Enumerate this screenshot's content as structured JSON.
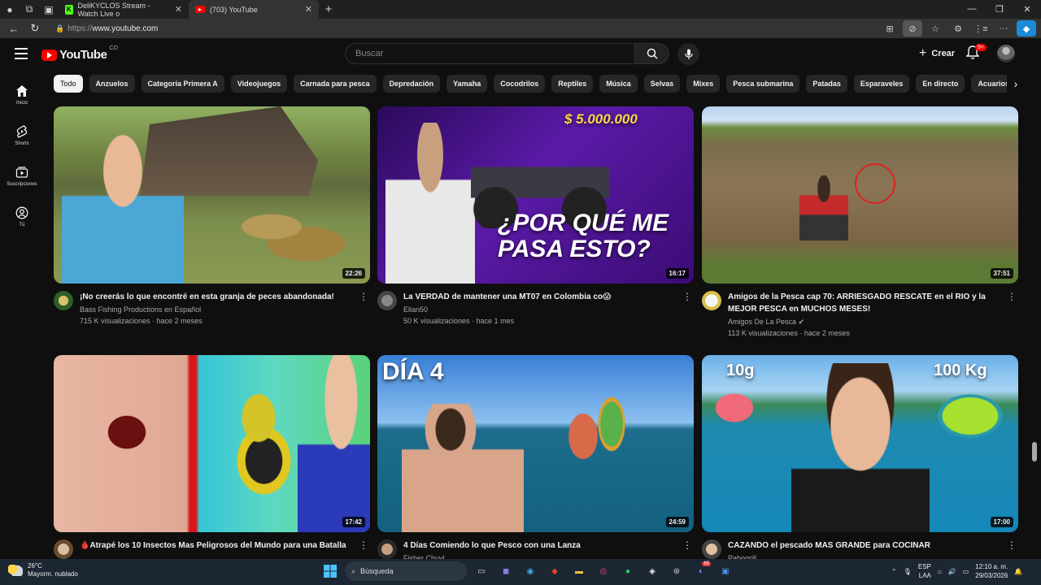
{
  "browser": {
    "tabs": [
      {
        "title": "DeliKYCLOS Stream - Watch Live o",
        "active": false
      },
      {
        "title": "(703) YouTube",
        "active": true
      }
    ],
    "url_protocol": "https://",
    "url_host": "www.youtube.com"
  },
  "header": {
    "logo_text": "YouTube",
    "country_code": "CO",
    "search_placeholder": "Buscar",
    "create_label": "Crear",
    "notifications_badge": "9+"
  },
  "sidebar": {
    "items": [
      {
        "label": "Inicio",
        "icon": "home-icon"
      },
      {
        "label": "Shorts",
        "icon": "shorts-icon"
      },
      {
        "label": "Suscripciones",
        "icon": "subscriptions-icon"
      },
      {
        "label": "Tú",
        "icon": "you-icon"
      }
    ]
  },
  "chips": [
    "Todo",
    "Anzuelos",
    "Categoría Primera A",
    "Videojuegos",
    "Carnada para pesca",
    "Depredación",
    "Yamaha",
    "Cocodrilos",
    "Reptiles",
    "Música",
    "Selvas",
    "Mixes",
    "Pesca submarina",
    "Patadas",
    "Esparaveles",
    "En directo",
    "Acuarios"
  ],
  "videos": [
    {
      "title": "¡No creerás lo que encontré en esta granja de peces abandonada!",
      "channel": "Bass Fishing Productions en Español",
      "stats": "715 K visualizaciones · hace 2 meses",
      "duration": "22:26",
      "thumb_text": ""
    },
    {
      "title": "La VERDAD de mantener una MT07 en Colombia co😱",
      "channel": "Elian50",
      "stats": "50 K visualizaciones · hace 1 mes",
      "duration": "16:17",
      "thumb_text": "¿POR QUÉ ME PASA ESTO?",
      "thumb_price": "$ 5.000.000"
    },
    {
      "title": "Amigos de la Pesca cap 70: ARRIESGADO RESCATE en el RIO y la MEJOR PESCA en MUCHOS MESES!",
      "channel": "Amigos De La Pesca ✔",
      "stats": "113 K visualizaciones · hace 2 meses",
      "duration": "37:51",
      "thumb_text": ""
    },
    {
      "title": "🩸Atrapé los 10 Insectos Mas Peligrosos del Mundo para una Batalla",
      "channel": "",
      "stats": "",
      "duration": "17:42",
      "thumb_text": ""
    },
    {
      "title": "4 Días Comiendo lo que Pesco con una Lanza",
      "channel": "Fisher Chuyl",
      "stats": "",
      "duration": "24:59",
      "thumb_text": "DÍA 4"
    },
    {
      "title": "CAZANDO el pescado MAS GRANDE para COCINAR",
      "channel": "Pabogrill",
      "stats": "",
      "duration": "17:00",
      "thumb_text": "",
      "thumb_left": "10g",
      "thumb_right": "100 Kg"
    }
  ],
  "taskbar": {
    "temperature": "26°C",
    "weather": "Mayorm. nublado",
    "search_label": "Búsqueda",
    "language": "ESP",
    "region": "LAA",
    "time": "12:10 a. m.",
    "date": "29/03/2026",
    "discord_badge": "65"
  }
}
